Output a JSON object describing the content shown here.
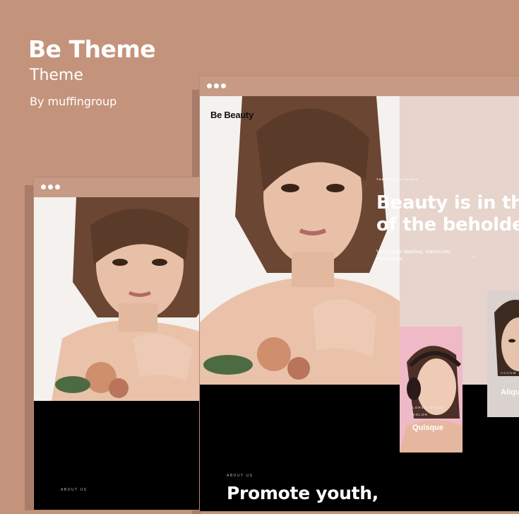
{
  "header": {
    "title": "Be Theme",
    "subtitle": "Theme",
    "author": "By muffingroup"
  },
  "colors": {
    "background": "#c4937b",
    "browser_bar": "#c79a85",
    "hero_panel": "#e6d4cd",
    "pink_card": "#f0b9c7"
  },
  "icons": {
    "window_dots": "three-dots-icon",
    "arrow": "arrow-right-icon"
  },
  "front": {
    "brand": "Be Beauty",
    "eyebrow": "THE BEAUTY CLINIC",
    "hero_title": "Beauty is in the\nof the beholder",
    "hero_desc": "Vestibulum dapibus, mauris nec malesuada",
    "arrow": "→",
    "card_mid": {
      "tag": "LOREM IPSUM\nDOLOR",
      "name": "Quisque"
    },
    "card_side": {
      "tag": "ACCUM\nCONGU",
      "name": "Aliqu"
    },
    "about": "ABOUT US",
    "promote": "Promote youth,"
  },
  "back": {
    "about": "ABOUT US"
  }
}
